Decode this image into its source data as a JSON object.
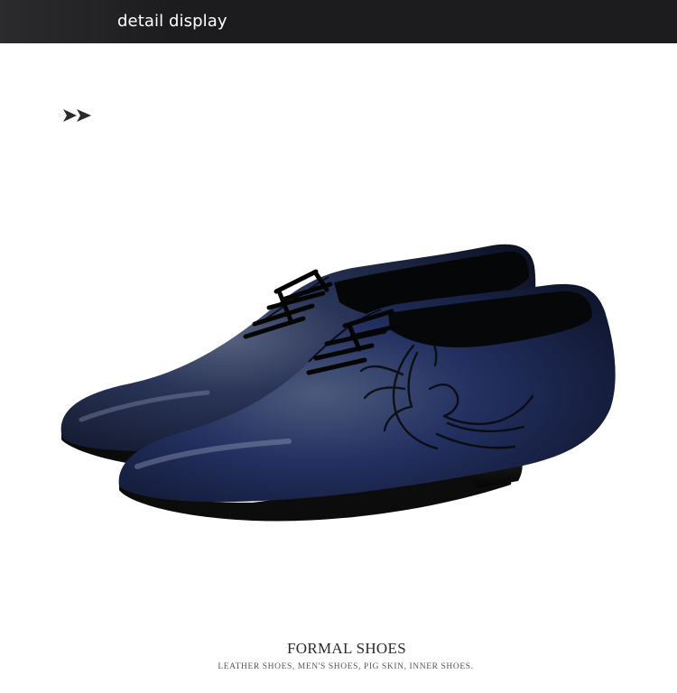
{
  "header": {
    "title": "detail display",
    "background_color": "#1c1c1e",
    "text_color": "#ffffff"
  },
  "decoration": {
    "arrow_icon": "double-chevron-right-icon"
  },
  "product": {
    "image_subject": "pair of navy blue leather oxford lace-up dress shoes with black phoenix print",
    "leather_color": "#1f2a4a",
    "sole_color": "#0d0d0f"
  },
  "caption": {
    "title": "FORMAL SHOES",
    "subtitle": "LEATHER SHOES, MEN'S SHOES, PIG SKIN, INNER SHOES."
  }
}
